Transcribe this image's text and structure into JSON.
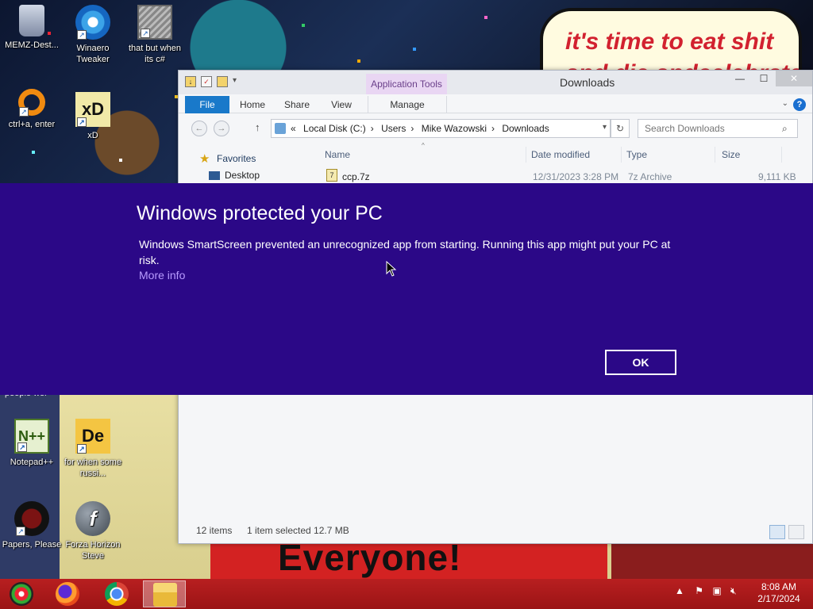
{
  "desktop": {
    "icons": [
      {
        "label": "MEMZ-Dest...",
        "icon": "recycle-bin-icon"
      },
      {
        "label": "Winaero Tweaker",
        "icon": "winaero-icon"
      },
      {
        "label": "that but when its c#",
        "icon": "stacked-windows-icon"
      },
      {
        "label": "ctrl+a, enter",
        "icon": "orange-ring-icon"
      },
      {
        "label": "xD",
        "icon": "xd-icon"
      },
      {
        "label": "Notepad++",
        "icon": "notepadpp-icon"
      },
      {
        "label": "for when some russi...",
        "icon": "de-icon"
      },
      {
        "label": "Papers, Please",
        "icon": "papers-please-icon"
      },
      {
        "label": "Forza Horizon Steve",
        "icon": "flash-icon"
      }
    ],
    "wallpaper": {
      "speech_line1": "it's time to eat shit",
      "speech_line2": "and die andcelebrate",
      "banner": "Everyone!",
      "partial_text": "people wer"
    }
  },
  "explorer": {
    "title": "Downloads",
    "context_tab": "Application Tools",
    "tabs": {
      "file": "File",
      "home": "Home",
      "share": "Share",
      "view": "View",
      "manage": "Manage"
    },
    "breadcrumb": {
      "prefix": "«",
      "items": [
        "Local Disk (C:)",
        "Users",
        "Mike Wazowski",
        "Downloads"
      ]
    },
    "search_placeholder": "Search Downloads",
    "columns": {
      "name": "Name",
      "date": "Date modified",
      "type": "Type",
      "size": "Size"
    },
    "nav": {
      "favorites": "Favorites",
      "desktop": "Desktop"
    },
    "rows": [
      {
        "name": "ccp.7z",
        "date": "12/31/2023 3:28 PM",
        "type": "7z Archive",
        "size": "9,111 KB"
      }
    ],
    "status": {
      "items": "12 items",
      "selected": "1 item selected  12.7 MB"
    }
  },
  "smartscreen": {
    "title": "Windows protected your PC",
    "body": "Windows SmartScreen prevented an unrecognized app from starting. Running this app might put your PC at risk.",
    "more_info": "More info",
    "ok": "OK",
    "background": "#2b0887",
    "link_color": "#b89bff"
  },
  "taskbar": {
    "apps": [
      "start-orb-icon",
      "firefox-icon",
      "chrome-icon",
      "file-explorer-icon"
    ],
    "time": "8:08 AM",
    "date": "2/17/2024"
  }
}
